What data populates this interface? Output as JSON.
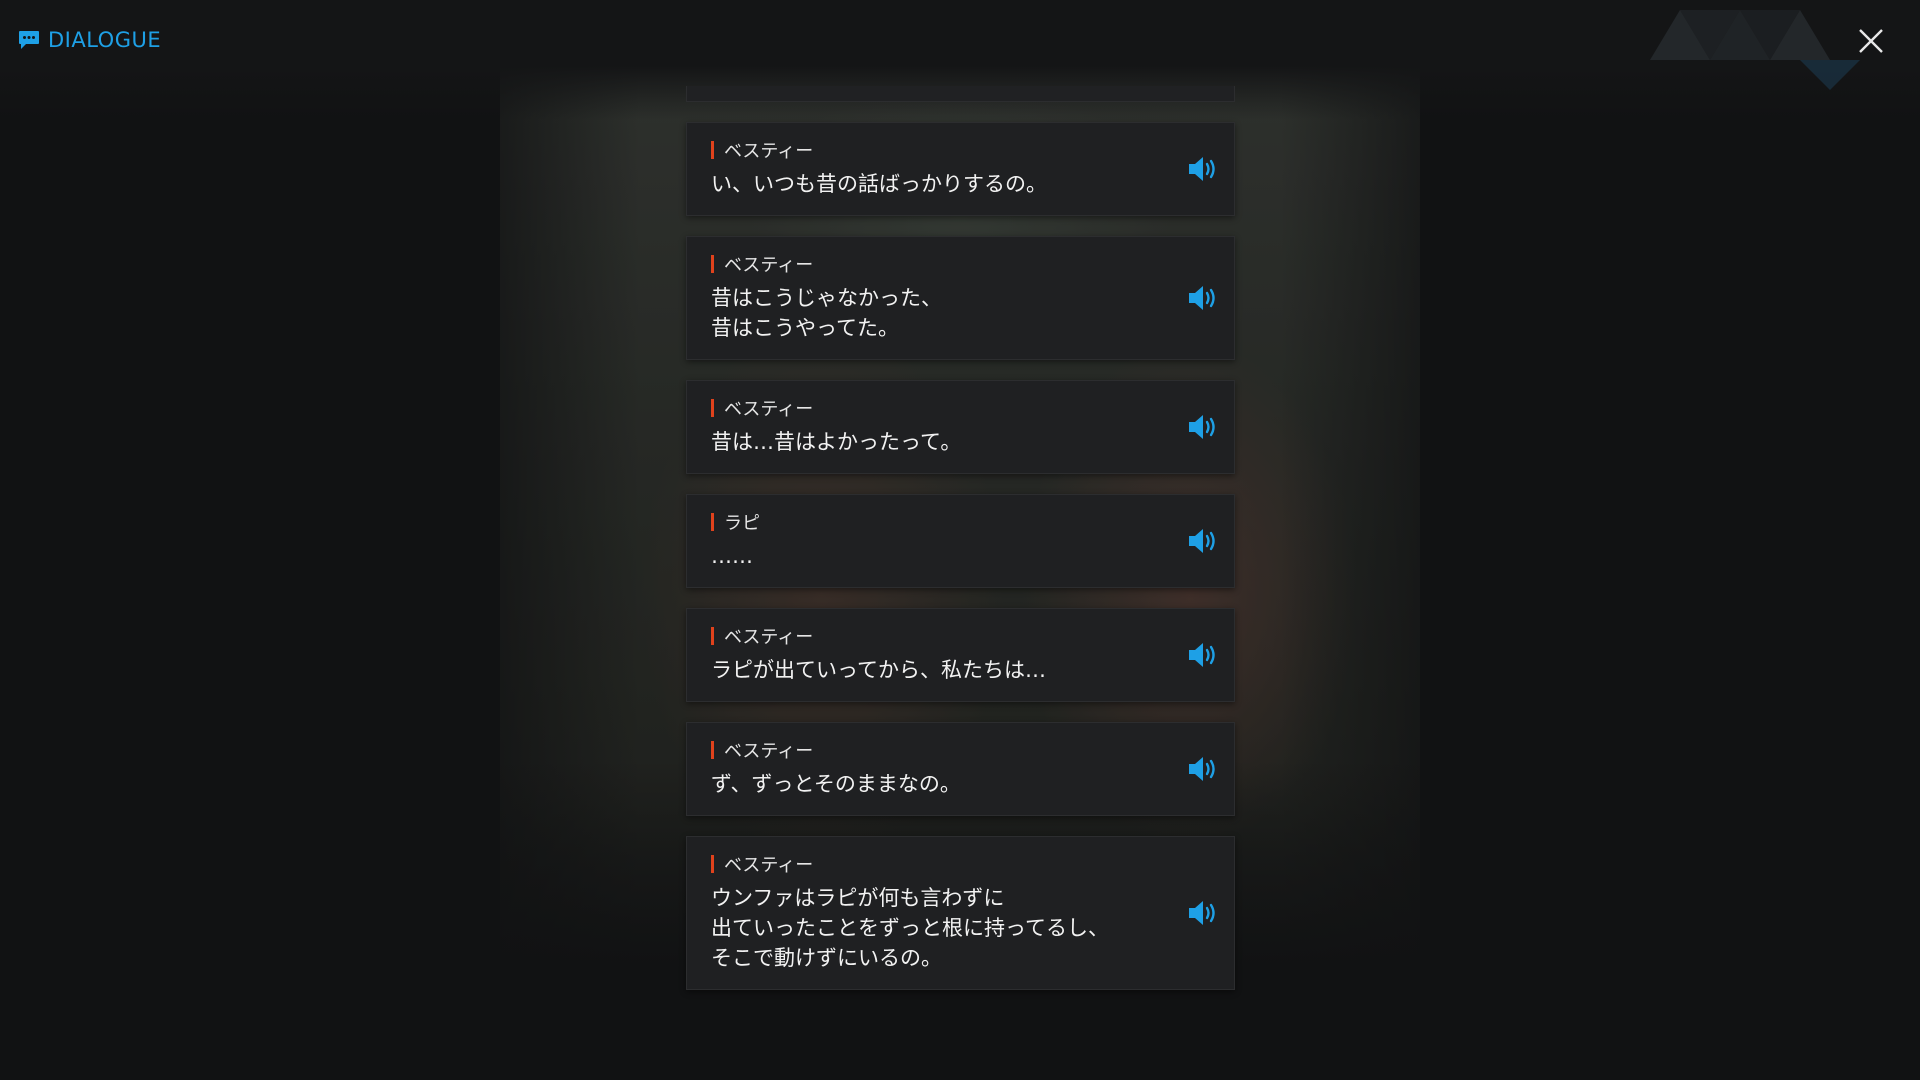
{
  "header": {
    "title": "DIALOGUE",
    "icon": "chat-bubble-icon"
  },
  "close_icon": "close-icon",
  "colors": {
    "accent": "#1ea0e6",
    "speaker_marker": "#e0421c",
    "card_bg": "#1f2022",
    "text": "#f2f2f2"
  },
  "dialogue": [
    {
      "speaker": "ベスティー",
      "text": "い、いつも昔の話ばっかりするの。",
      "voice_icon": "speaker-volume-icon"
    },
    {
      "speaker": "ベスティー",
      "text": "昔はこうじゃなかった、\n昔はこうやってた。",
      "voice_icon": "speaker-volume-icon"
    },
    {
      "speaker": "ベスティー",
      "text": "昔は…昔はよかったって。",
      "voice_icon": "speaker-volume-icon"
    },
    {
      "speaker": "ラピ",
      "text": "……",
      "voice_icon": "speaker-volume-icon"
    },
    {
      "speaker": "ベスティー",
      "text": "ラピが出ていってから、私たちは…",
      "voice_icon": "speaker-volume-icon"
    },
    {
      "speaker": "ベスティー",
      "text": "ず、ずっとそのままなの。",
      "voice_icon": "speaker-volume-icon"
    },
    {
      "speaker": "ベスティー",
      "text": "ウンファはラピが何も言わずに\n出ていったことをずっと根に持ってるし、\nそこで動けずにいるの。",
      "voice_icon": "speaker-volume-icon"
    }
  ]
}
